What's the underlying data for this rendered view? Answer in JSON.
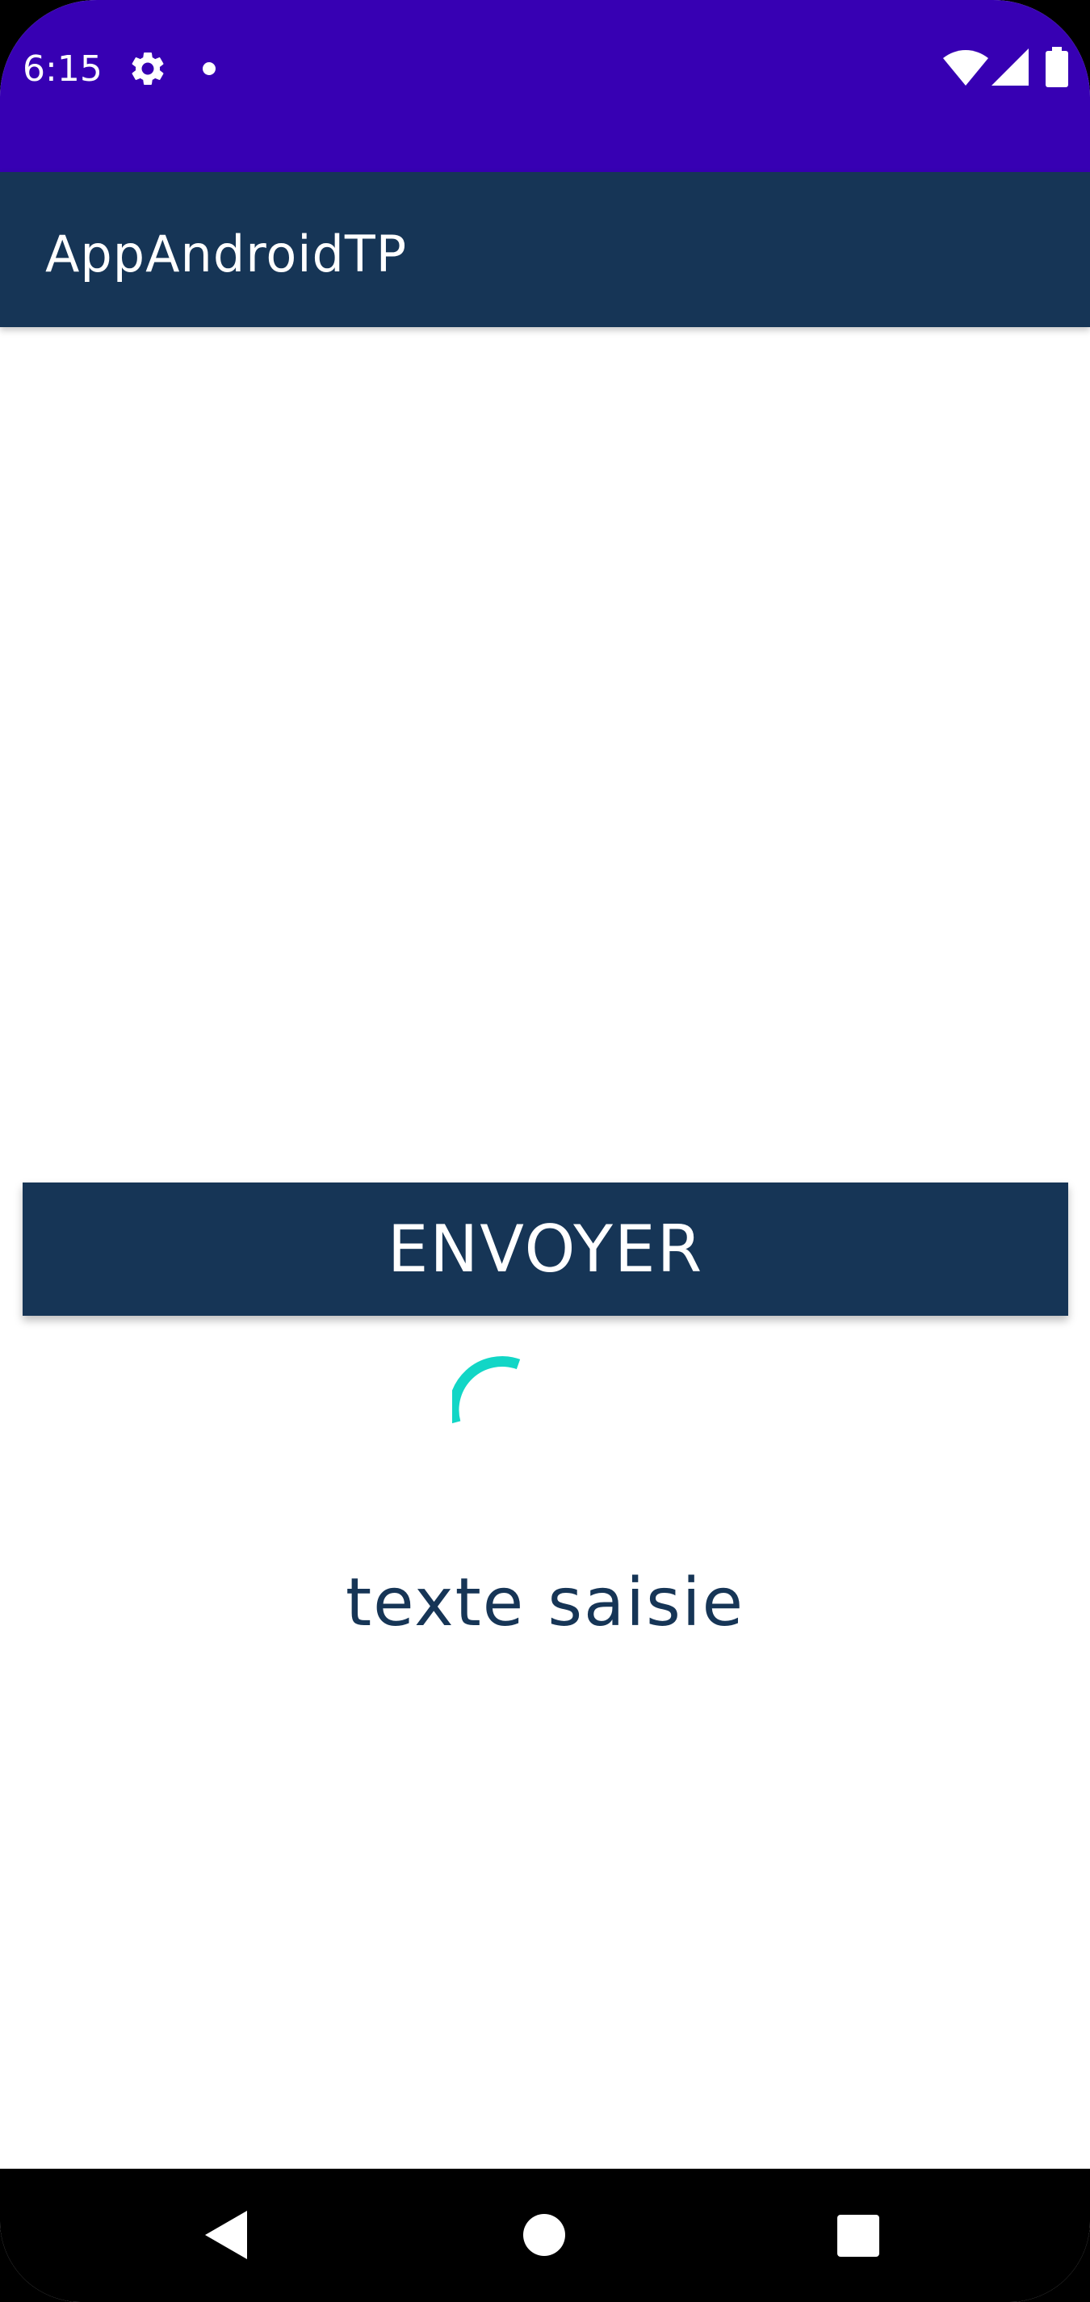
{
  "status_bar": {
    "time": "6:15",
    "icons": [
      "gear-icon",
      "notification-dot-icon",
      "wifi-icon",
      "signal-icon",
      "battery-icon"
    ],
    "background_color": "#3700b3"
  },
  "app_bar": {
    "title": "AppAndroidTP",
    "background_color": "#163556"
  },
  "main": {
    "send_button_label": "ENVOYER",
    "spinner_color": "#12d6c6",
    "result_text": "texte saisie",
    "text_color": "#163556"
  },
  "nav_bar": {
    "buttons": [
      "back-icon",
      "home-icon",
      "recents-icon"
    ]
  }
}
